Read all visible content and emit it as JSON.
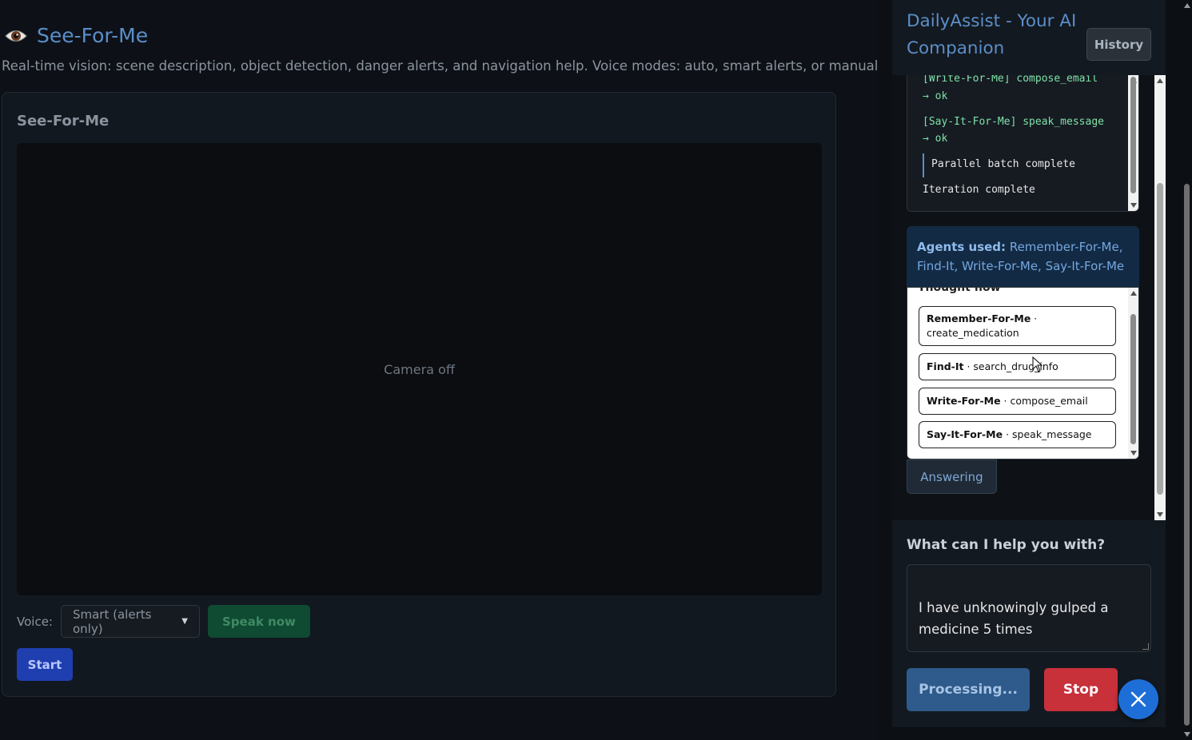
{
  "page": {
    "title": "See-For-Me",
    "description": "Real-time vision: scene description, object detection, danger alerts, and navigation help. Voice modes: auto, smart alerts, or manual.",
    "icon": "eye-icon"
  },
  "card": {
    "title": "See-For-Me",
    "camera_status": "Camera off",
    "voice_label": "Voice:",
    "voice_selected": "Smart (alerts only)",
    "speak_label": "Speak now",
    "start_label": "Start"
  },
  "assistant": {
    "title": "DailyAssist - Your AI Companion",
    "history_label": "History",
    "log": {
      "line1": "[Write-For-Me] compose_email",
      "line1b": "→ ok",
      "line2": "[Say-It-For-Me] speak_message",
      "line2b": "→ ok",
      "line3": "Parallel batch complete",
      "line4": "Iteration complete"
    },
    "agents_label": "Agents used:",
    "agents_value": "Remember-For-Me, Find-It, Write-For-Me, Say-It-For-Me",
    "thought_flow": {
      "heading": "Thought flow",
      "items": [
        {
          "agent": "Remember-For-Me",
          "sep": " · ",
          "action": "create_medication"
        },
        {
          "agent": "Find-It",
          "sep": " · ",
          "action": "search_drug_info"
        },
        {
          "agent": "Write-For-Me",
          "sep": " · ",
          "action": "compose_email"
        },
        {
          "agent": "Say-It-For-Me",
          "sep": " · ",
          "action": "speak_message"
        }
      ]
    },
    "answering_label": "Answering",
    "help_label": "What can I help you with?",
    "input_value": "I have unknowingly gulped a medicine 5 times",
    "processing_label": "Processing...",
    "stop_label": "Stop",
    "close_icon": "close-icon"
  },
  "colors": {
    "accent": "#5b8ec9",
    "background": "#0d1117",
    "stop": "#c8303a",
    "fab": "#1e6ed8",
    "speak": "#0f4a33",
    "start": "#1f3fb0"
  }
}
